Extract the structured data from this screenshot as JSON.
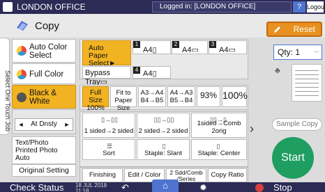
{
  "header": {
    "office": "LONDON OFFICE",
    "logged_in": "Logged in: [LONDON OFFICE]",
    "logout": "Logout",
    "help": "?"
  },
  "title": "Copy",
  "reset": "Reset",
  "side_tab": "Select One Touch Job",
  "color_mode": {
    "auto": "Auto Color Select",
    "full": "Full Color",
    "bw": "Black & White"
  },
  "density": {
    "label": "At Dnsty",
    "left": "◄",
    "right": "►"
  },
  "original_type": "Text/Photo\nPrinted Photo\nAuto",
  "original_setting": "Original Setting",
  "paper": {
    "auto": "Auto Paper Select►",
    "tray1": {
      "num": "1",
      "size": "A4▯"
    },
    "tray2": {
      "num": "2",
      "size": "A4▭"
    },
    "tray3": {
      "num": "3",
      "size": "A4▭"
    },
    "bypass": "Bypass Tray▭",
    "tray4": {
      "num": "4",
      "size": "A4▯"
    }
  },
  "zoom": {
    "full_size": "Full Size\n100%",
    "fit": "Fit to\nPaper Size",
    "a3a4": "A3→A4\nB4→B5",
    "a4a3": "A4→A3\nB5→B4",
    "p93": "93%",
    "p100": "100%"
  },
  "functions": {
    "f1": "1 sided→2 sided",
    "f2": "2 sided→2 sided",
    "f3": "1sided→Comb 2orig",
    "f4": "Sort",
    "f5": "Staple: Slant",
    "f6": "Staple: Center"
  },
  "tabs": {
    "finishing": "Finishing",
    "edit_color": "Edit / Color",
    "sided": "2 Sdd/Comb\n/Series",
    "ratio": "Copy Ratio"
  },
  "qty_label": "Qty: 1",
  "sample_copy": "Sample Copy",
  "start": "Start",
  "bottom": {
    "check_status": "Check Status",
    "date": "18 JUL 2018\n11:18",
    "stop": "Stop"
  },
  "colors": {
    "header_bg": "#2b2b55",
    "accent_yellow": "#f2b322",
    "reset_orange": "#e89020",
    "start_green": "#1f9e62",
    "home_blue": "#4f74d0"
  }
}
